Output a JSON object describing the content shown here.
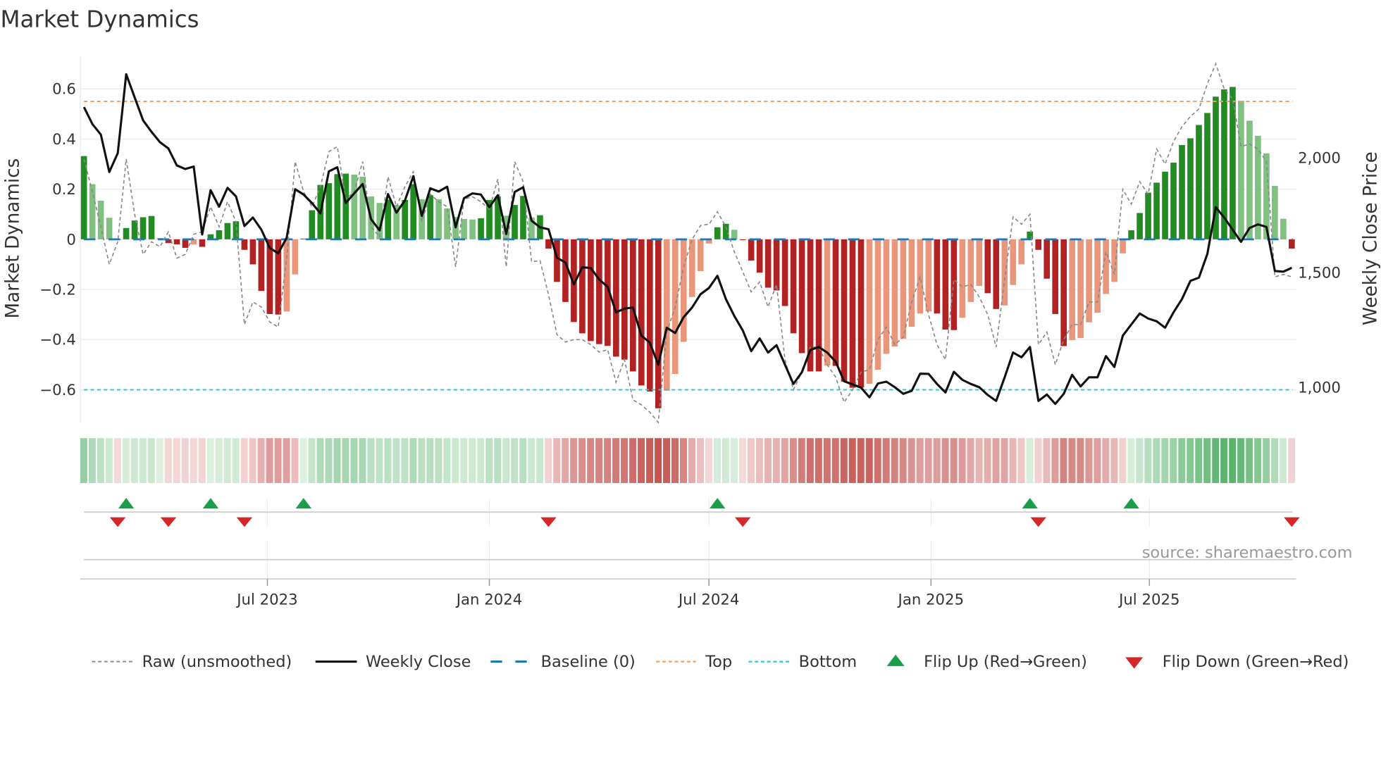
{
  "title": "Market Dynamics",
  "source": "source: sharemaestro.com",
  "colors": {
    "up_strong": "#228b22",
    "up_weak": "#80c080",
    "down_strong": "#b22222",
    "down_weak": "#e9967a",
    "raw": "#888888",
    "close": "#111111",
    "baseline": "#1f77b4",
    "top": "#f0a060",
    "bottom": "#30c8d8",
    "flip_up": "#1a9e4a",
    "flip_down": "#d62728"
  },
  "chart_data": {
    "type": "bar",
    "title": "Market Dynamics",
    "ylabel": "Market Dynamics",
    "y2label": "Weekly Close Price",
    "ylim": [
      -0.73,
      0.73
    ],
    "y2lim": [
      847,
      2441
    ],
    "yticks": [
      0.6,
      0.4,
      0.2,
      0,
      -0.2,
      -0.4,
      -0.6
    ],
    "ytick_labels": [
      "0.6",
      "0.4",
      "0.2",
      "0",
      "−0.2",
      "−0.4",
      "−0.6"
    ],
    "y2ticks": [
      2000,
      1500,
      1000
    ],
    "y2tick_labels": [
      "2,000",
      "1,500",
      "1,000"
    ],
    "x_start": "2023-01-30",
    "x_step_days": 7,
    "xticks": [
      "2023-07-01",
      "2024-01-01",
      "2024-07-01",
      "2025-01-01",
      "2025-07-01"
    ],
    "xtick_labels": [
      "Jul 2023",
      "Jan 2024",
      "Jul 2024",
      "Jan 2025",
      "Jul 2025"
    ],
    "top_level": 0.55,
    "bottom_level": -0.6,
    "baseline": 0,
    "grid": true,
    "legend_position": "bottom",
    "legend": [
      "Raw (unsmoothed)",
      "Weekly Close",
      "Baseline (0)",
      "Top",
      "Bottom",
      "Flip Up (Red→Green)",
      "Flip Down (Green→Red)"
    ],
    "momentum": [
      0.332,
      0.22,
      0.154,
      0.086,
      -0.003,
      0.045,
      0.075,
      0.088,
      0.093,
      0.005,
      -0.015,
      -0.02,
      -0.034,
      -0.02,
      -0.03,
      0.02,
      0.036,
      0.065,
      0.072,
      -0.042,
      -0.1,
      -0.206,
      -0.298,
      -0.3,
      -0.288,
      -0.14,
      0.003,
      0.116,
      0.217,
      0.224,
      0.26,
      0.262,
      0.258,
      0.25,
      0.171,
      0.145,
      0.158,
      0.137,
      0.157,
      0.22,
      0.16,
      0.176,
      0.16,
      0.123,
      0.089,
      0.081,
      0.079,
      0.084,
      0.157,
      0.171,
      0.094,
      0.137,
      0.173,
      0.087,
      0.096,
      -0.037,
      -0.17,
      -0.25,
      -0.33,
      -0.375,
      -0.406,
      -0.418,
      -0.425,
      -0.468,
      -0.48,
      -0.527,
      -0.583,
      -0.607,
      -0.674,
      -0.604,
      -0.537,
      -0.409,
      -0.23,
      -0.127,
      -0.017,
      0.048,
      0.062,
      0.038,
      -0.003,
      -0.085,
      -0.133,
      -0.193,
      -0.204,
      -0.266,
      -0.375,
      -0.454,
      -0.527,
      -0.527,
      -0.503,
      -0.505,
      -0.568,
      -0.592,
      -0.592,
      -0.576,
      -0.52,
      -0.457,
      -0.428,
      -0.397,
      -0.349,
      -0.296,
      -0.288,
      -0.296,
      -0.36,
      -0.362,
      -0.313,
      -0.25,
      -0.186,
      -0.215,
      -0.278,
      -0.264,
      -0.182,
      -0.1,
      0.031,
      -0.042,
      -0.157,
      -0.298,
      -0.426,
      -0.402,
      -0.394,
      -0.331,
      -0.293,
      -0.218,
      -0.17,
      -0.056,
      0.036,
      0.105,
      0.186,
      0.226,
      0.27,
      0.306,
      0.376,
      0.403,
      0.456,
      0.504,
      0.569,
      0.598,
      0.608,
      0.553,
      0.473,
      0.413,
      0.343,
      0.213,
      0.082,
      -0.037
    ],
    "close": [
      2220,
      2146,
      2100,
      1937,
      2019,
      2363,
      2262,
      2162,
      2112,
      2067,
      2040,
      1966,
      1950,
      1961,
      1665,
      1858,
      1786,
      1868,
      1831,
      1702,
      1739,
      1686,
      1606,
      1583,
      1651,
      1862,
      1839,
      1802,
      1757,
      1940,
      1958,
      1802,
      1844,
      1885,
      1731,
      1683,
      1841,
      1760,
      1813,
      1919,
      1746,
      1866,
      1852,
      1873,
      1696,
      1823,
      1844,
      1839,
      1784,
      1836,
      1667,
      1850,
      1871,
      1725,
      1696,
      1688,
      1564,
      1543,
      1448,
      1522,
      1519,
      1469,
      1437,
      1326,
      1342,
      1347,
      1225,
      1194,
      1098,
      1259,
      1236,
      1305,
      1347,
      1405,
      1432,
      1485,
      1384,
      1310,
      1247,
      1157,
      1212,
      1151,
      1183,
      1098,
      1014,
      1065,
      1162,
      1175,
      1151,
      1111,
      1026,
      1012,
      998,
      956,
      1016,
      1024,
      1000,
      971,
      984,
      1059,
      1058,
      1014,
      977,
      1067,
      1032,
      1014,
      1000,
      966,
      940,
      1042,
      1151,
      1130,
      1175,
      940,
      968,
      927,
      971,
      1054,
      1003,
      1043,
      1043,
      1135,
      1088,
      1225,
      1273,
      1321,
      1299,
      1287,
      1259,
      1326,
      1384,
      1463,
      1477,
      1580,
      1784,
      1739,
      1686,
      1633,
      1693,
      1709,
      1698,
      1506,
      1503,
      1520
    ],
    "raw": [
      0.32,
      0.19,
      0.05,
      -0.1,
      -0.01,
      0.32,
      0.1,
      -0.06,
      -0.01,
      -0.03,
      0.03,
      -0.075,
      -0.06,
      0.02,
      0.03,
      0.13,
      0.05,
      0.15,
      0.07,
      -0.34,
      -0.25,
      -0.27,
      -0.33,
      -0.35,
      -0.075,
      0.31,
      0.19,
      0.13,
      0.21,
      0.35,
      0.37,
      0.16,
      0.19,
      0.31,
      0.05,
      0.01,
      0.25,
      0.13,
      0.21,
      0.27,
      0.07,
      0.18,
      0.15,
      0.13,
      -0.11,
      0.16,
      0.17,
      0.15,
      0.12,
      0.24,
      -0.11,
      0.31,
      0.23,
      -0.09,
      -0.085,
      -0.22,
      -0.38,
      -0.41,
      -0.4,
      -0.4,
      -0.42,
      -0.45,
      -0.44,
      -0.57,
      -0.48,
      -0.64,
      -0.66,
      -0.69,
      -0.73,
      -0.37,
      -0.27,
      -0.11,
      0.0,
      0.055,
      0.06,
      0.11,
      0.05,
      -0.05,
      -0.13,
      -0.21,
      -0.17,
      -0.27,
      -0.18,
      -0.48,
      -0.6,
      -0.53,
      -0.43,
      -0.43,
      -0.5,
      -0.55,
      -0.65,
      -0.6,
      -0.53,
      -0.52,
      -0.4,
      -0.35,
      -0.42,
      -0.39,
      -0.25,
      -0.15,
      -0.3,
      -0.42,
      -0.48,
      -0.16,
      -0.19,
      -0.18,
      -0.23,
      -0.3,
      -0.43,
      -0.16,
      0.09,
      0.06,
      0.1,
      -0.42,
      -0.37,
      -0.5,
      -0.4,
      -0.34,
      -0.34,
      -0.25,
      -0.25,
      -0.05,
      -0.14,
      0.2,
      0.14,
      0.23,
      0.18,
      0.36,
      0.3,
      0.39,
      0.45,
      0.49,
      0.52,
      0.62,
      0.7,
      0.6,
      0.56,
      0.37,
      0.38,
      0.36,
      0.31,
      -0.15,
      -0.14,
      -0.15
    ]
  }
}
